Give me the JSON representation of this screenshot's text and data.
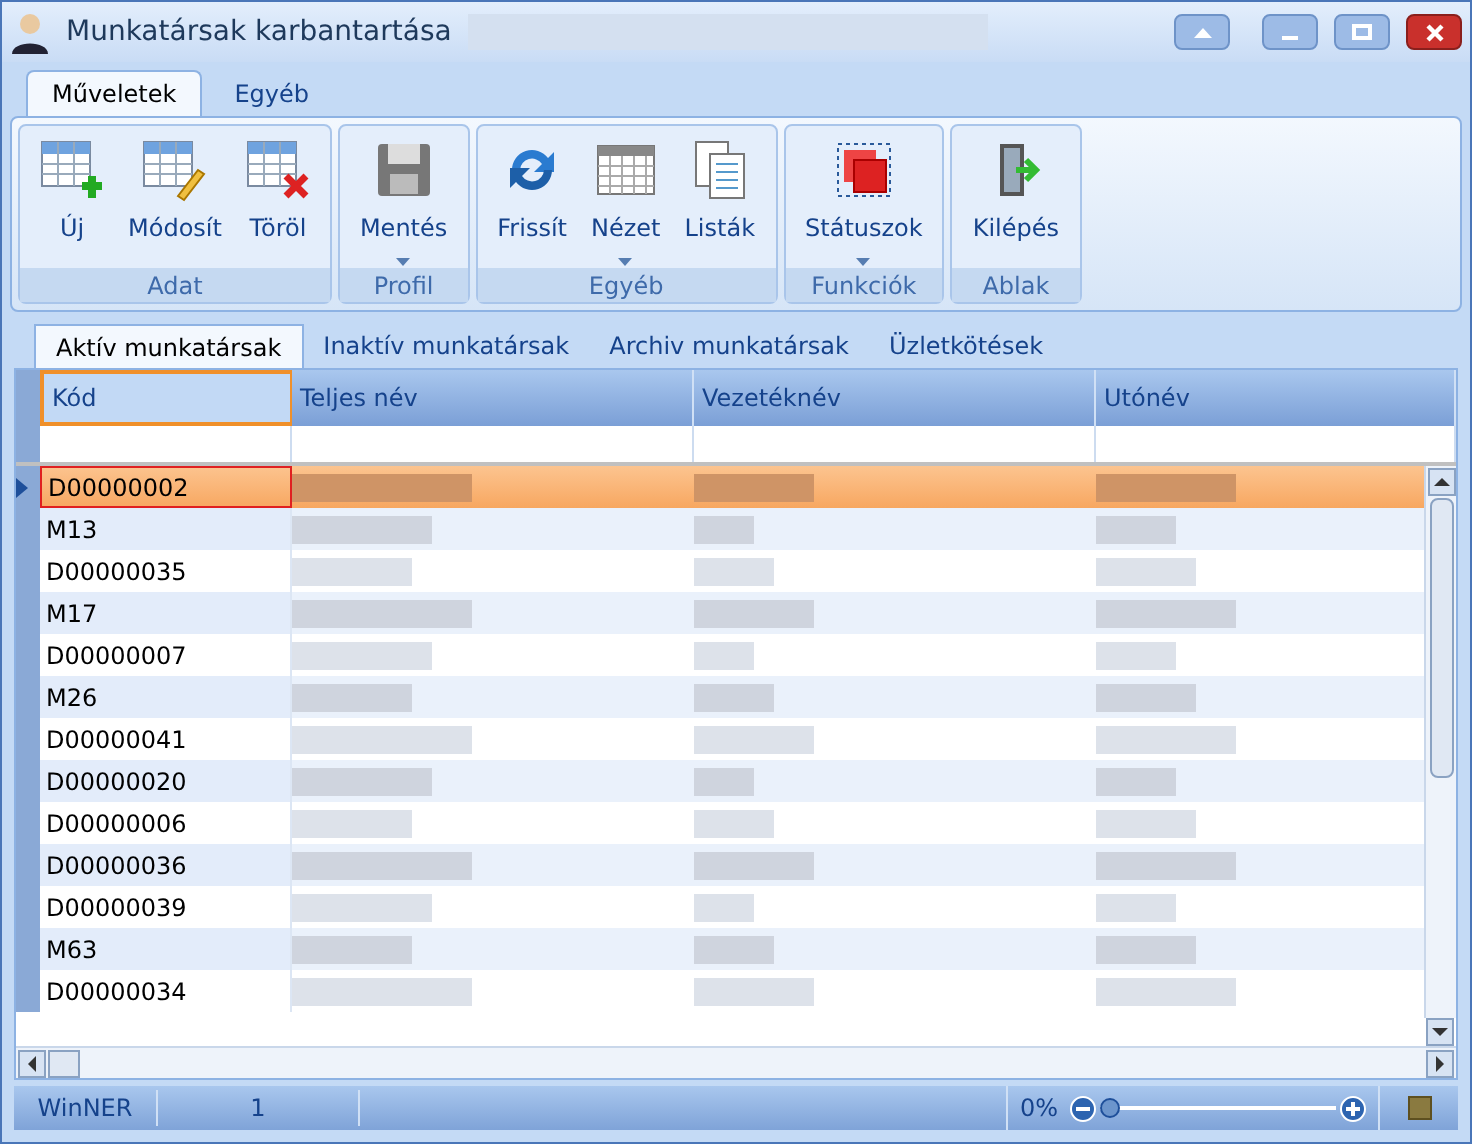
{
  "window": {
    "title": "Munkatársak karbantartása"
  },
  "ribbon_tabs": [
    {
      "label": "Műveletek",
      "selected": true
    },
    {
      "label": "Egyéb",
      "selected": false
    }
  ],
  "ribbon_groups": [
    {
      "label": "Adat",
      "buttons": [
        {
          "label": "Új",
          "kind": "new",
          "dropdown": false
        },
        {
          "label": "Módosít",
          "kind": "edit",
          "dropdown": false
        },
        {
          "label": "Töröl",
          "kind": "delete",
          "dropdown": false
        }
      ]
    },
    {
      "label": "Profil",
      "buttons": [
        {
          "label": "Mentés",
          "kind": "save",
          "dropdown": true
        }
      ]
    },
    {
      "label": "Egyéb",
      "buttons": [
        {
          "label": "Frissít",
          "kind": "refresh",
          "dropdown": false
        },
        {
          "label": "Nézet",
          "kind": "view",
          "dropdown": true
        },
        {
          "label": "Listák",
          "kind": "lists",
          "dropdown": false
        }
      ]
    },
    {
      "label": "Funkciók",
      "buttons": [
        {
          "label": "Státuszok",
          "kind": "status",
          "dropdown": true
        }
      ]
    },
    {
      "label": "Ablak",
      "buttons": [
        {
          "label": "Kilépés",
          "kind": "exit",
          "dropdown": false
        }
      ]
    }
  ],
  "tabs": [
    {
      "label": "Aktív munkatársak",
      "selected": true
    },
    {
      "label": "Inaktív munkatársak",
      "selected": false
    },
    {
      "label": "Archiv munkatársak",
      "selected": false
    },
    {
      "label": "Üzletkötések",
      "selected": false
    }
  ],
  "table": {
    "columns": [
      "Kód",
      "Teljes név",
      "Vezetéknév",
      "Utónév"
    ],
    "rows": [
      {
        "code": "D00000002",
        "selected": true
      },
      {
        "code": "M13",
        "selected": false
      },
      {
        "code": "D00000035",
        "selected": false
      },
      {
        "code": "M17",
        "selected": false
      },
      {
        "code": "D00000007",
        "selected": false
      },
      {
        "code": "M26",
        "selected": false
      },
      {
        "code": "D00000041",
        "selected": false
      },
      {
        "code": "D00000020",
        "selected": false
      },
      {
        "code": "D00000006",
        "selected": false
      },
      {
        "code": "D00000036",
        "selected": false
      },
      {
        "code": "D00000039",
        "selected": false
      },
      {
        "code": "M63",
        "selected": false
      },
      {
        "code": "D00000034",
        "selected": false
      }
    ]
  },
  "status_bar": {
    "app": "WinNER",
    "count": "1",
    "zoom": {
      "reading": "0%",
      "level": 0
    }
  }
}
